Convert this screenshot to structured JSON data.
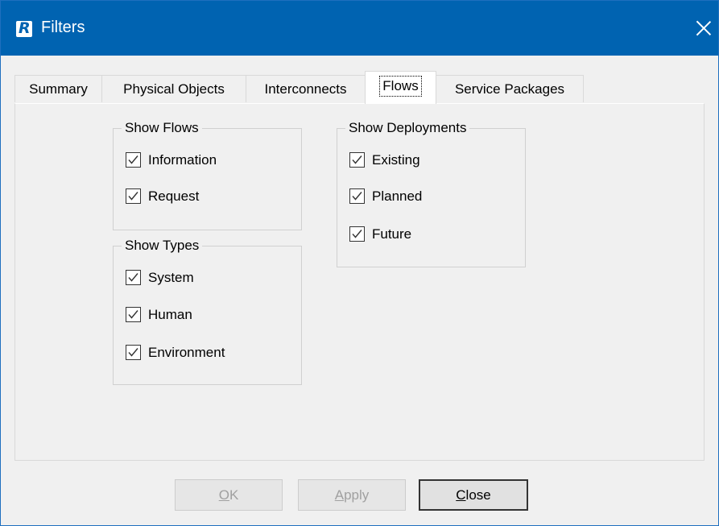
{
  "window": {
    "title": "Filters",
    "app_icon_letter": "R"
  },
  "tabs": [
    {
      "label": "Summary"
    },
    {
      "label": "Physical Objects"
    },
    {
      "label": "Interconnects"
    },
    {
      "label": "Flows",
      "active": true
    },
    {
      "label": "Service Packages"
    }
  ],
  "show_flows": {
    "title": "Show Flows",
    "items": [
      {
        "label": "Information",
        "checked": true
      },
      {
        "label": "Request",
        "checked": true
      }
    ]
  },
  "show_types": {
    "title": "Show Types",
    "items": [
      {
        "label": "System",
        "checked": true
      },
      {
        "label": "Human",
        "checked": true
      },
      {
        "label": "Environment",
        "checked": true
      }
    ]
  },
  "show_deployments": {
    "title": "Show Deployments",
    "items": [
      {
        "label": "Existing",
        "checked": true
      },
      {
        "label": "Planned",
        "checked": true
      },
      {
        "label": "Future",
        "checked": true
      }
    ]
  },
  "buttons": {
    "ok": {
      "mnemonic": "O",
      "rest": "K",
      "enabled": false
    },
    "apply": {
      "mnemonic": "A",
      "rest": "pply",
      "enabled": false
    },
    "close": {
      "mnemonic": "C",
      "rest": "lose",
      "enabled": true
    }
  }
}
